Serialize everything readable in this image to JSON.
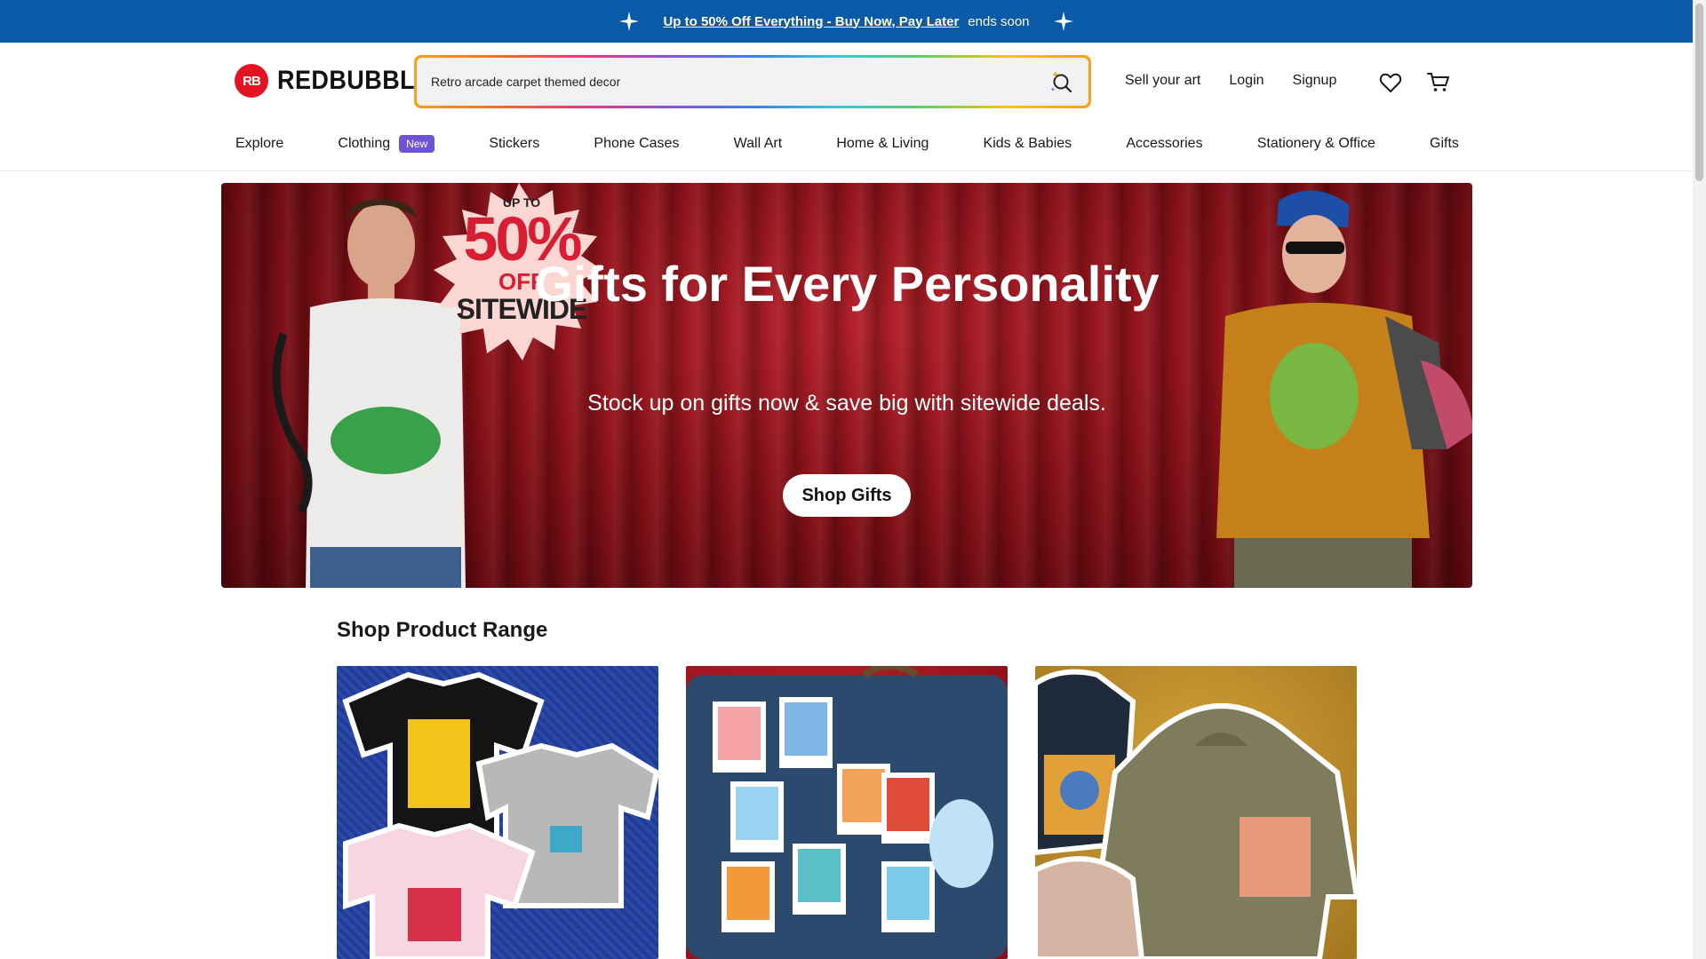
{
  "promo": {
    "link_text": "Up to 50% Off Everything - Buy Now, Pay Later",
    "suffix": "ends soon"
  },
  "header": {
    "logo_mark": "RB",
    "logo_text": "REDBUBBLE",
    "search_value": "Retro arcade carpet themed decor",
    "links": {
      "sell": "Sell your art",
      "login": "Login",
      "signup": "Signup"
    }
  },
  "nav": {
    "explore": "Explore",
    "clothing": "Clothing",
    "clothing_badge": "New",
    "stickers": "Stickers",
    "phone_cases": "Phone Cases",
    "wall_art": "Wall Art",
    "home_living": "Home & Living",
    "kids_babies": "Kids & Babies",
    "accessories": "Accessories",
    "stationery": "Stationery & Office",
    "gifts": "Gifts"
  },
  "hero": {
    "title": "Gifts for Every Personality",
    "subtitle": "Stock up on gifts now & save big with sitewide deals.",
    "button": "Shop Gifts",
    "burst": {
      "up_to": "UP TO",
      "percent": "50%",
      "off": "OFF",
      "sitewide": "SITEWIDE"
    }
  },
  "product_range": {
    "title": "Shop Product Range"
  },
  "colors": {
    "promo_bg": "#0a5aa8",
    "brand_red": "#e41321",
    "badge": "#6c53d9"
  }
}
